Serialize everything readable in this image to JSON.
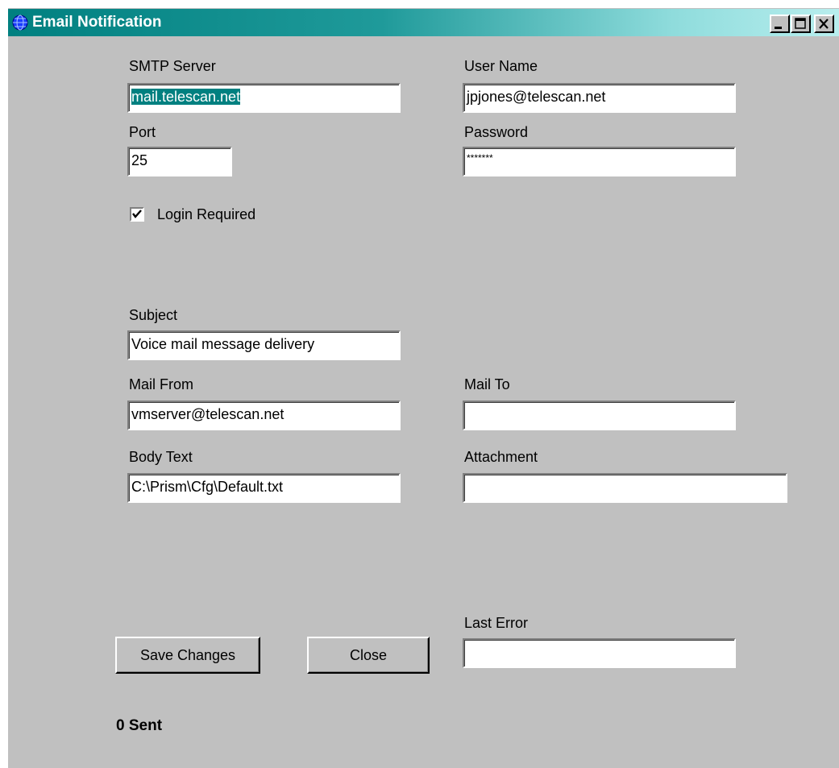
{
  "window": {
    "title": "Email Notification",
    "titlebar_icon": "globe-icon",
    "controls": [
      "minimize-icon",
      "maximize-icon",
      "close-icon"
    ]
  },
  "form": {
    "smtp_server": {
      "label": "SMTP Server",
      "value": "mail.telescan.net"
    },
    "user_name": {
      "label": "User Name",
      "value": "jpjones@telescan.net"
    },
    "port": {
      "label": "Port",
      "value": "25"
    },
    "password": {
      "label": "Password",
      "value": "*******"
    },
    "login_required": {
      "label": "Login Required",
      "checked": true
    },
    "subject": {
      "label": "Subject",
      "value": "Voice mail message delivery"
    },
    "mail_from": {
      "label": "Mail From",
      "value": "vmserver@telescan.net"
    },
    "mail_to": {
      "label": "Mail To",
      "value": ""
    },
    "body_text": {
      "label": "Body Text",
      "value": "C:\\Prism\\Cfg\\Default.txt"
    },
    "attachment": {
      "label": "Attachment",
      "value": ""
    },
    "last_error": {
      "label": "Last Error",
      "value": ""
    }
  },
  "buttons": {
    "save": "Save Changes",
    "close": "Close"
  },
  "status": {
    "sent": "0 Sent"
  },
  "colors": {
    "titlebar_start": "#008080",
    "titlebar_end": "#b8eeee",
    "face": "#c0c0c0",
    "selection": "#008080"
  }
}
